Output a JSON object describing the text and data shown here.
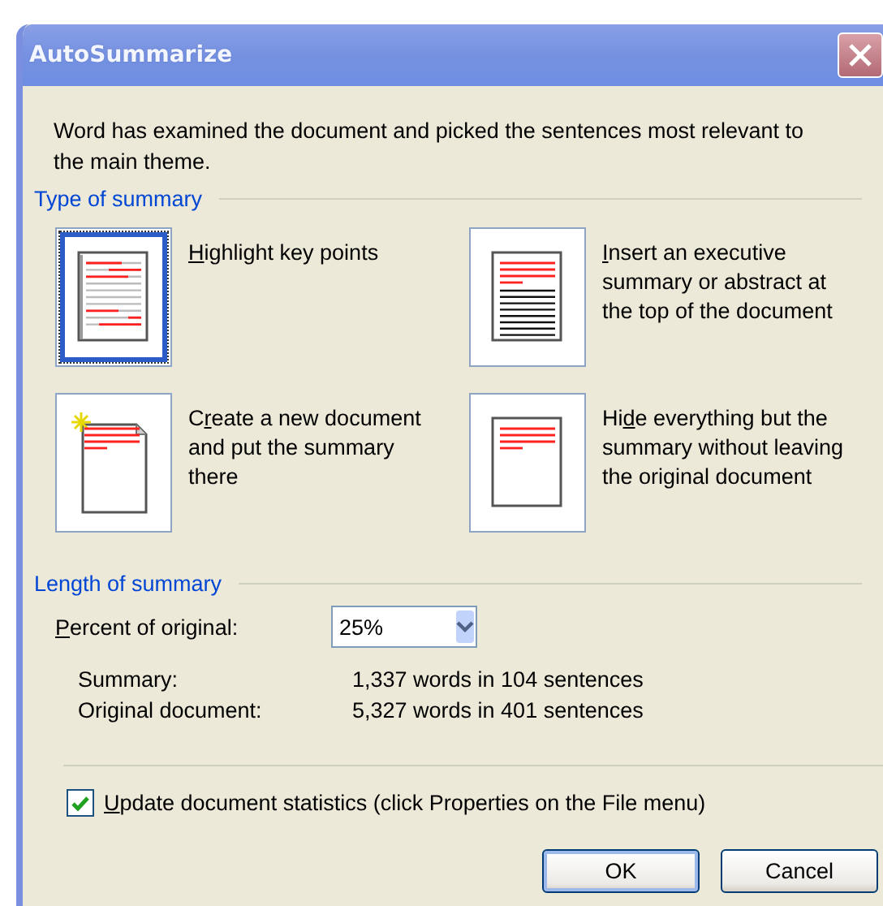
{
  "window": {
    "title": "AutoSummarize"
  },
  "intro": "Word has examined the document and picked the sentences most relevant to the main theme.",
  "type_of_summary": {
    "heading": "Type of summary",
    "options": [
      {
        "kind": "highlight",
        "access_key": "H",
        "label_after": "ighlight key points",
        "selected": true
      },
      {
        "kind": "insert",
        "access_key": "I",
        "label_after": "nsert an executive summary or abstract at the top of the document",
        "selected": false
      },
      {
        "kind": "new",
        "label_before": "C",
        "access_key": "r",
        "label_after": "eate a new document and put the summary there",
        "selected": false
      },
      {
        "kind": "hide",
        "label_before": "Hi",
        "access_key": "d",
        "label_after": "e everything but the summary without leaving the original document",
        "selected": false
      }
    ]
  },
  "length_of_summary": {
    "heading": "Length of summary",
    "percent": {
      "access_key": "P",
      "label_after": "ercent of original:",
      "value": "25%"
    },
    "stats": [
      {
        "label": "Summary:",
        "value": "1,337 words in 104 sentences"
      },
      {
        "label": "Original document:",
        "value": "5,327 words in 401 sentences"
      }
    ]
  },
  "update_statistics": {
    "access_key": "U",
    "label_after": "pdate document statistics (click Properties on the File menu)",
    "checked": true
  },
  "buttons": [
    {
      "label": "OK",
      "default": true
    },
    {
      "label": "Cancel",
      "default": false
    }
  ]
}
